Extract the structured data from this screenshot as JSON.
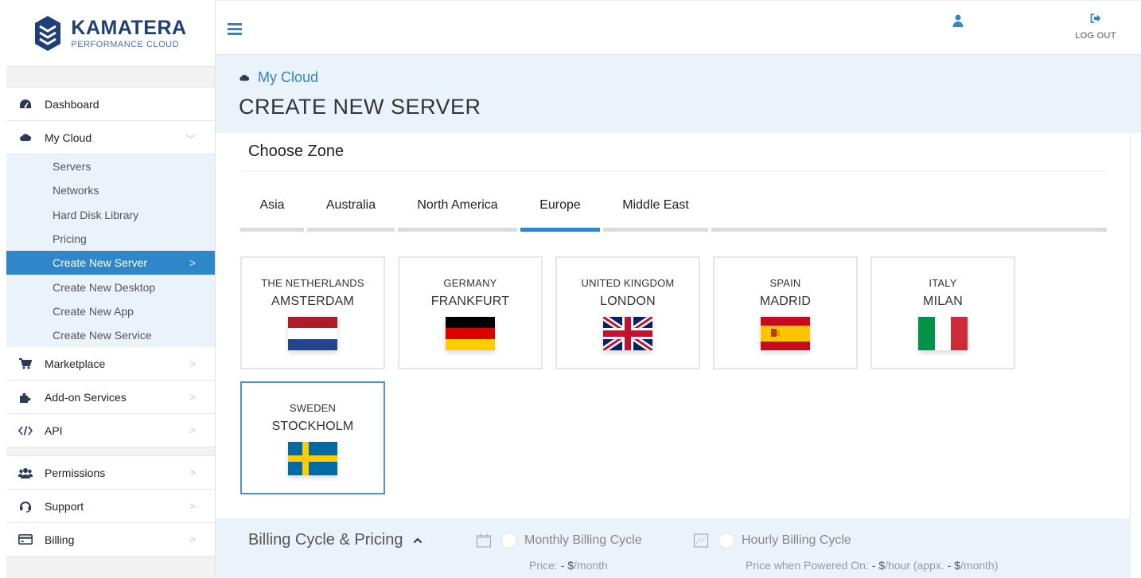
{
  "brand": {
    "name": "KAMATERA",
    "tagline": "PERFORMANCE CLOUD",
    "color": "#1f3f7a"
  },
  "topbar": {
    "menu_icon": "hamburger-icon",
    "user_icon": "user-icon",
    "logout_icon": "logout-icon",
    "logout_label": "LOG OUT"
  },
  "sidebar": {
    "items_top": [
      {
        "label": "Dashboard",
        "icon": "dashboard-gauge-icon"
      },
      {
        "label": "My Cloud",
        "icon": "cloud-icon",
        "expanded": true
      }
    ],
    "sub_items": [
      {
        "label": "Servers"
      },
      {
        "label": "Networks"
      },
      {
        "label": "Hard Disk Library"
      },
      {
        "label": "Pricing"
      },
      {
        "label": "Create New Server",
        "active": true
      },
      {
        "label": "Create New Desktop"
      },
      {
        "label": "Create New App"
      },
      {
        "label": "Create New Service"
      }
    ],
    "items_mid": [
      {
        "label": "Marketplace",
        "icon": "cart-icon"
      },
      {
        "label": "Add-on Services",
        "icon": "puzzle-icon"
      },
      {
        "label": "API",
        "icon": "code-icon"
      }
    ],
    "items_bottom": [
      {
        "label": "Permissions",
        "icon": "users-icon"
      },
      {
        "label": "Support",
        "icon": "headset-icon"
      },
      {
        "label": "Billing",
        "icon": "credit-card-icon"
      }
    ],
    "chevron": ">",
    "chevron_down": "﹀"
  },
  "header": {
    "breadcrumb": "My Cloud",
    "title": "CREATE NEW SERVER"
  },
  "zone_section": {
    "title": "Choose Zone",
    "tabs": [
      {
        "label": "Asia"
      },
      {
        "label": "Australia"
      },
      {
        "label": "North America"
      },
      {
        "label": "Europe",
        "active": true
      },
      {
        "label": "Middle East"
      }
    ],
    "zones": [
      {
        "country": "THE NETHERLANDS",
        "city": "AMSTERDAM",
        "flag": "netherlands-flag-icon"
      },
      {
        "country": "GERMANY",
        "city": "FRANKFURT",
        "flag": "germany-flag-icon"
      },
      {
        "country": "UNITED KINGDOM",
        "city": "LONDON",
        "flag": "uk-flag-icon"
      },
      {
        "country": "SPAIN",
        "city": "MADRID",
        "flag": "spain-flag-icon"
      },
      {
        "country": "ITALY",
        "city": "MILAN",
        "flag": "italy-flag-icon"
      },
      {
        "country": "SWEDEN",
        "city": "STOCKHOLM",
        "flag": "sweden-flag-icon",
        "selected": true
      }
    ]
  },
  "billing": {
    "title": "Billing Cycle & Pricing",
    "monthly": {
      "label": "Monthly Billing Cycle",
      "price_prefix": "Price: ",
      "price_value": "- $",
      "price_suffix": "/month"
    },
    "hourly": {
      "label": "Hourly Billing Cycle",
      "price_prefix": "Price when Powered On: ",
      "price_value": "- $",
      "price_mid": "/hour (appx. ",
      "price_value2": "- $",
      "price_suffix": "/month)"
    }
  },
  "colors": {
    "accent": "#2f86c9",
    "header_band": "#eaf3fa",
    "selected_border": "#4a94cf"
  }
}
